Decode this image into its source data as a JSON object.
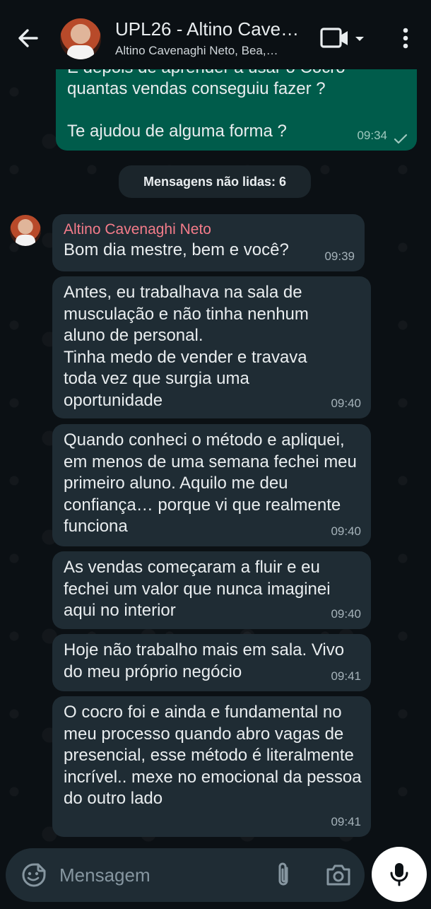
{
  "header": {
    "title": "UPL26 - Altino Cave…",
    "subtitle": "Altino Cavenaghi Neto, Bea,…",
    "icons": [
      "back-arrow-icon",
      "video-call-icon",
      "chevron-down-icon",
      "more-vert-icon"
    ]
  },
  "messages": {
    "outgoing_top": {
      "lines": [
        "E depois de aprender a usar o Cocro",
        "quantas vendas conseguiu fazer ?",
        "",
        "Te ajudou de alguma forma ?"
      ],
      "text_line1": "E depois de aprender a usar o Cocro",
      "text_line2": "quantas vendas conseguiu fazer ?",
      "text_line3": "Te ajudou de alguma forma ?",
      "time": "09:34",
      "status": "sent-check"
    },
    "unread_label": "Mensagens não lidas: 6",
    "incoming": [
      {
        "sender": "Altino Cavenaghi Neto",
        "text": "Bom dia mestre, bem e você?",
        "time": "09:39"
      },
      {
        "text": "Antes, eu trabalhava na sala de musculação e não tinha nenhum aluno de personal.\nTinha medo de vender e travava toda vez que surgia uma oportunidade",
        "time": "09:40"
      },
      {
        "text": "Quando conheci o método e apliquei, em menos de uma semana fechei meu primeiro aluno. Aquilo me deu confiança… porque vi que realmente funciona",
        "time": "09:40"
      },
      {
        "text": "As vendas começaram a fluir e eu fechei um valor que nunca imaginei aqui no interior",
        "time": "09:40"
      },
      {
        "text": "Hoje não trabalho mais em sala. Vivo do meu próprio negócio",
        "time": "09:41"
      },
      {
        "text": "O cocro foi e ainda e fundamental no meu processo quando abro vagas de presencial, esse método é literalmente incrível.. mexe no emocional da pessoa do outro lado",
        "time": "09:41"
      }
    ]
  },
  "composer": {
    "placeholder": "Mensagem",
    "icons": [
      "emoji-sticker-icon",
      "attach-icon",
      "camera-icon",
      "mic-icon"
    ]
  },
  "colors": {
    "background": "#0b1014",
    "incoming_bubble": "#1f2c34",
    "outgoing_bubble": "#005c4b",
    "sender_name": "#f47c8a"
  }
}
